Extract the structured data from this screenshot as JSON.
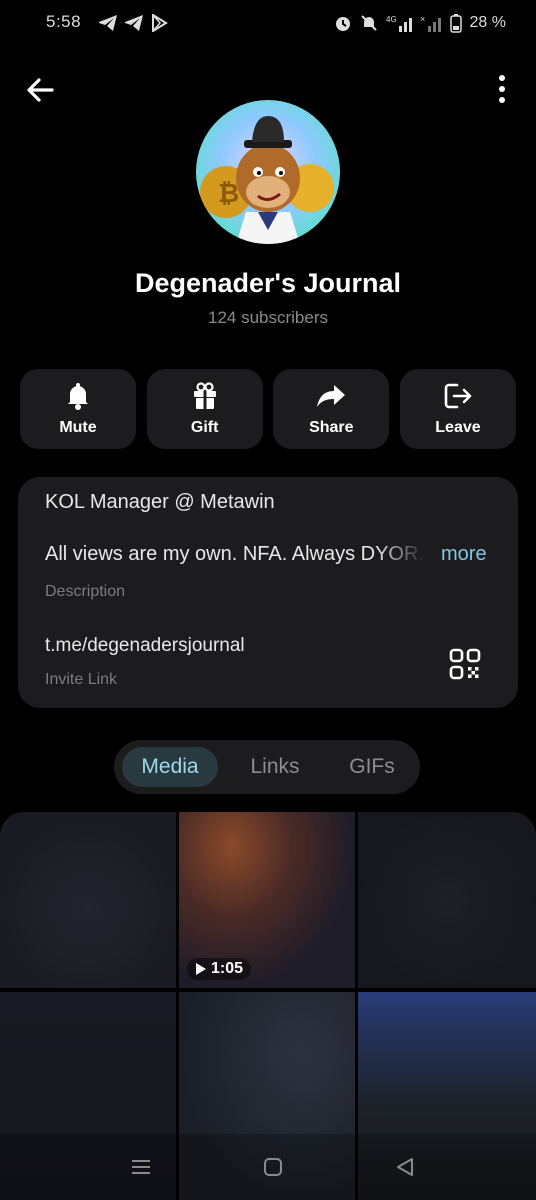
{
  "status_bar": {
    "time": "5:58",
    "battery": "28 %",
    "left_icons": [
      "telegram-icon",
      "telegram-icon",
      "play-store-icon"
    ],
    "right_icons": [
      "alarm-icon",
      "mute-icon",
      "4g-signal-icon",
      "no-signal-icon",
      "battery-icon"
    ]
  },
  "header": {
    "back_icon": "back-arrow-icon",
    "menu_icon": "more-vertical-icon"
  },
  "channel": {
    "title": "Degenader's Journal",
    "subscribers": "124 subscribers"
  },
  "actions": [
    {
      "label": "Mute",
      "icon": "bell-icon"
    },
    {
      "label": "Gift",
      "icon": "gift-icon"
    },
    {
      "label": "Share",
      "icon": "share-icon"
    },
    {
      "label": "Leave",
      "icon": "leave-icon"
    }
  ],
  "info": {
    "headline": "KOL Manager @ Metawin",
    "description": "All views are my own.  NFA. Always DYOR.",
    "more_label": "more",
    "description_label": "Description",
    "invite_link": "t.me/degenadersjournal",
    "invite_link_label": "Invite Link"
  },
  "tabs": [
    {
      "label": "Media",
      "active": true
    },
    {
      "label": "Links",
      "active": false
    },
    {
      "label": "GIFs",
      "active": false
    }
  ],
  "media": {
    "video_duration": "1:05"
  },
  "colors": {
    "background": "#000000",
    "card": "#1c1c1e",
    "accent": "#7ec8e3",
    "active_tab_bg": "#28393f"
  }
}
